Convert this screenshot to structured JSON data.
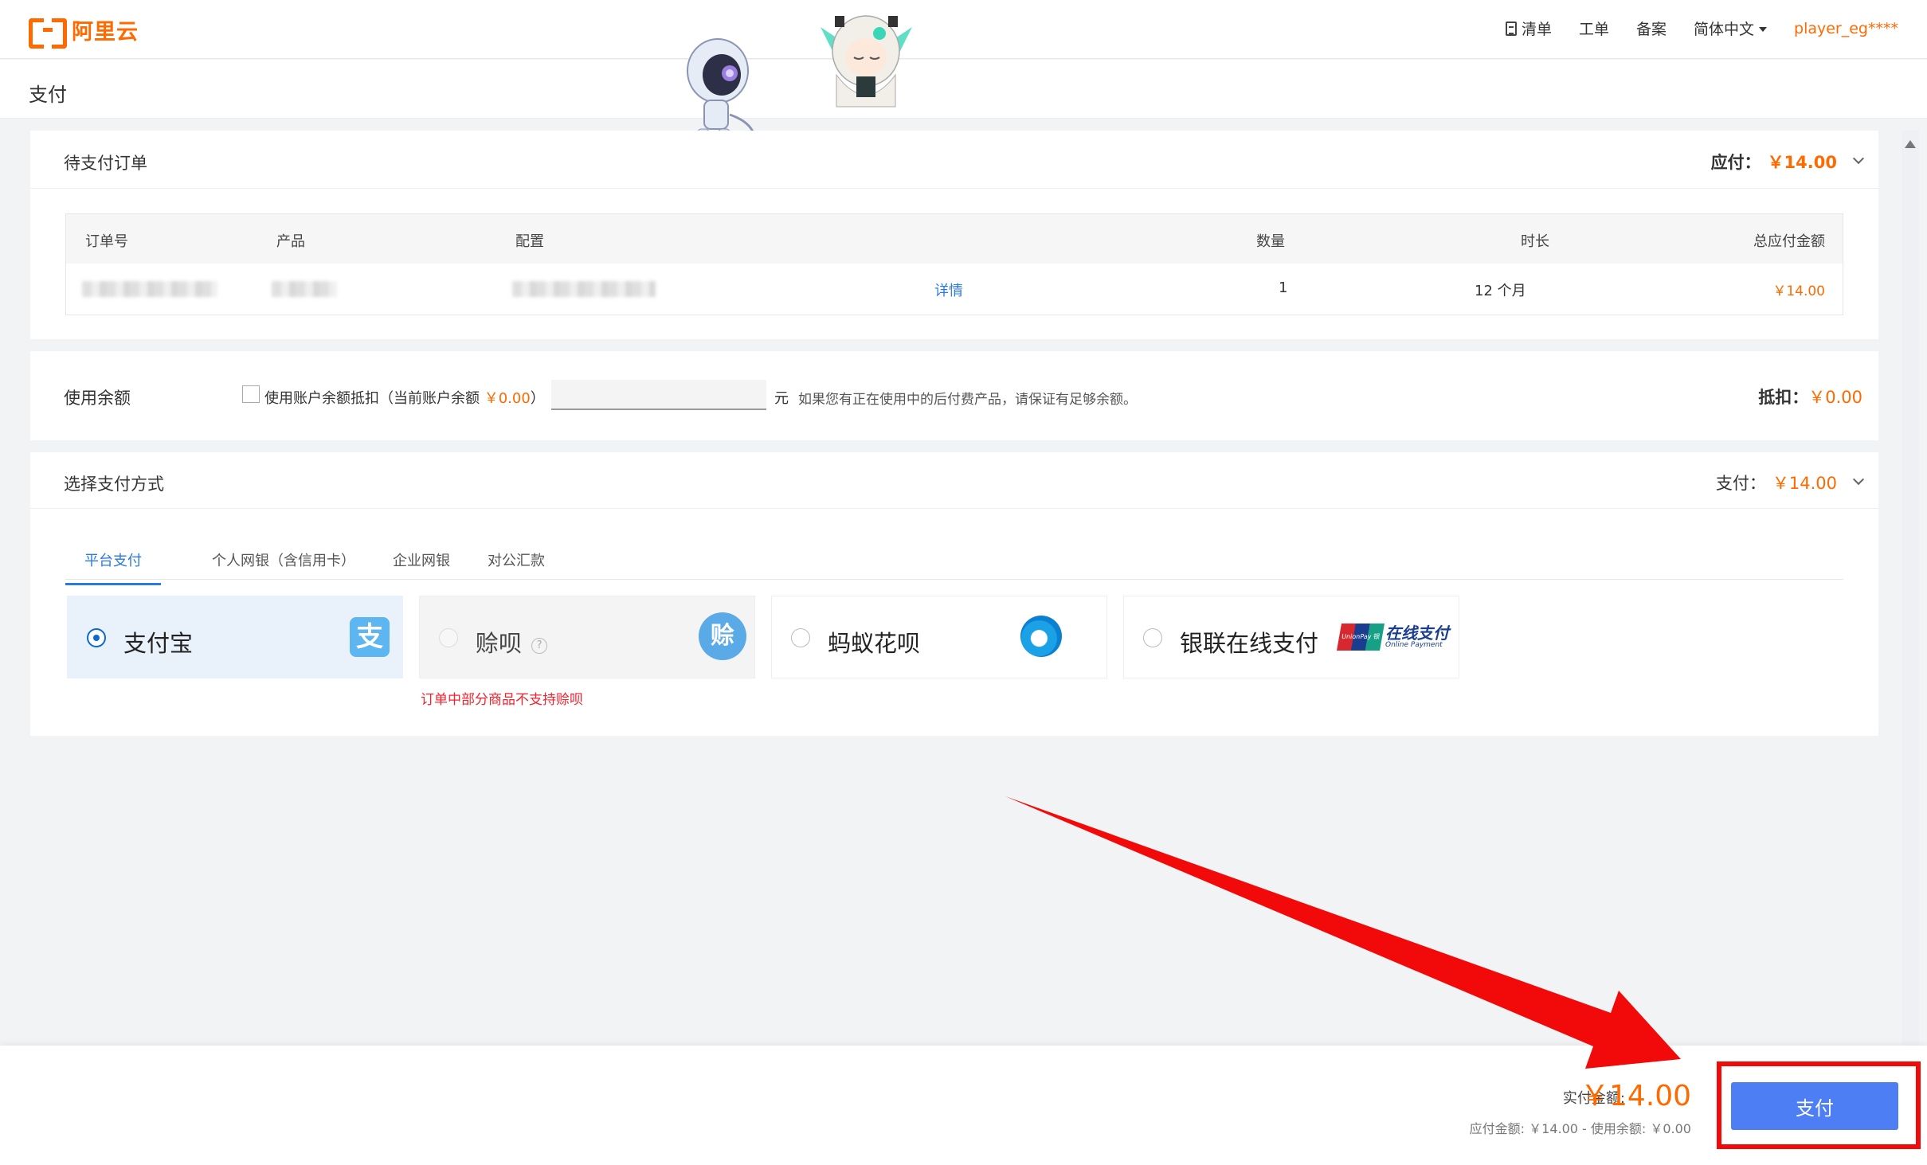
{
  "topbar": {
    "logo_text": "阿里云",
    "nav": {
      "list": "清单",
      "ticket": "工单",
      "filing": "备案",
      "language": "简体中文",
      "user": "player_eg****"
    }
  },
  "page_title": "支付",
  "order": {
    "title": "待支付订单",
    "due_label": "应付：",
    "due_amount": "￥14.00",
    "columns": {
      "order_no": "订单号",
      "product": "产品",
      "config": "配置",
      "qty": "数量",
      "duration": "时长",
      "total": "总应付金额"
    },
    "row": {
      "detail_link": "详情",
      "qty": "1",
      "duration": "12 个月",
      "total": "￥14.00"
    }
  },
  "balance": {
    "title": "使用余额",
    "checkbox_label_prefix": "使用账户余额抵扣（当前账户余额 ",
    "current_balance": "￥0.00",
    "checkbox_label_suffix": "）",
    "input_value": "",
    "unit": "元",
    "hint": "如果您有正在使用中的后付费产品，请保证有足够余额。",
    "deduct_label": "抵扣：",
    "deduct_amount": "￥0.00"
  },
  "payment": {
    "title": "选择支付方式",
    "pay_label": "支付：",
    "pay_amount": "￥14.00",
    "tabs": [
      "平台支付",
      "个人网银（含信用卡）",
      "企业网银",
      "对公汇款"
    ],
    "methods": {
      "alipay": "支付宝",
      "shoubei": "赊呗",
      "huabei": "蚂蚁花呗",
      "unionpay": "银联在线支付"
    },
    "icons": {
      "alipay": "支",
      "shoubei": "赊",
      "unionpay_card": "UnionPay 银联",
      "unionpay_text": "在线支付",
      "unionpay_sub": "Online Payment"
    },
    "warning": "订单中部分商品不支持赊呗"
  },
  "footer": {
    "actual_label": "实付金额:",
    "actual_amount": "￥14.00",
    "detail": "应付金额: ￥14.00 - 使用余额: ￥0.00",
    "pay_button": "支付"
  },
  "colors": {
    "accent_orange": "#ff6a00",
    "link_blue": "#2a7ae2",
    "pay_button": "#4d7ef4",
    "annotation_red": "#f20a0a"
  }
}
